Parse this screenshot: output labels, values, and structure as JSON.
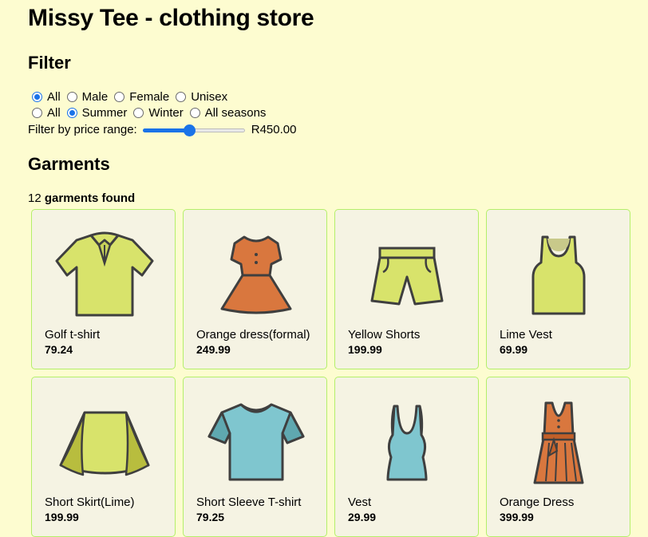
{
  "title": "Missy Tee - clothing store",
  "filter": {
    "heading": "Filter",
    "gender_options": [
      "All",
      "Male",
      "Female",
      "Unisex"
    ],
    "gender_selected": 0,
    "season_options": [
      "All",
      "Summer",
      "Winter",
      "All seasons"
    ],
    "season_selected": 1,
    "price_label": "Filter by price range:",
    "price_value": "R450.00",
    "price_slider_fraction": 0.45
  },
  "garments": {
    "heading": "Garments",
    "count": "12",
    "found_label": "garments found",
    "items": [
      {
        "name": "Golf t-shirt",
        "price": "79.24",
        "icon": "golf-shirt-icon"
      },
      {
        "name": "Orange dress(formal)",
        "price": "249.99",
        "icon": "orange-dress-icon"
      },
      {
        "name": "Yellow Shorts",
        "price": "199.99",
        "icon": "shorts-icon"
      },
      {
        "name": "Lime Vest",
        "price": "69.99",
        "icon": "vest-icon"
      },
      {
        "name": "Short Skirt(Lime)",
        "price": "199.99",
        "icon": "skirt-icon"
      },
      {
        "name": "Short Sleeve T-shirt",
        "price": "79.25",
        "icon": "tshirt-icon"
      },
      {
        "name": "Vest",
        "price": "29.99",
        "icon": "tank-top-icon"
      },
      {
        "name": "Orange Dress",
        "price": "399.99",
        "icon": "sleeveless-dress-icon"
      }
    ]
  },
  "colors": {
    "background": "#fdfcd0",
    "accent": "#1a73e8",
    "card_border": "#b4ef6a",
    "lime": "#d8e36b",
    "orange": "#d9773e",
    "blue": "#7fc6cf"
  }
}
